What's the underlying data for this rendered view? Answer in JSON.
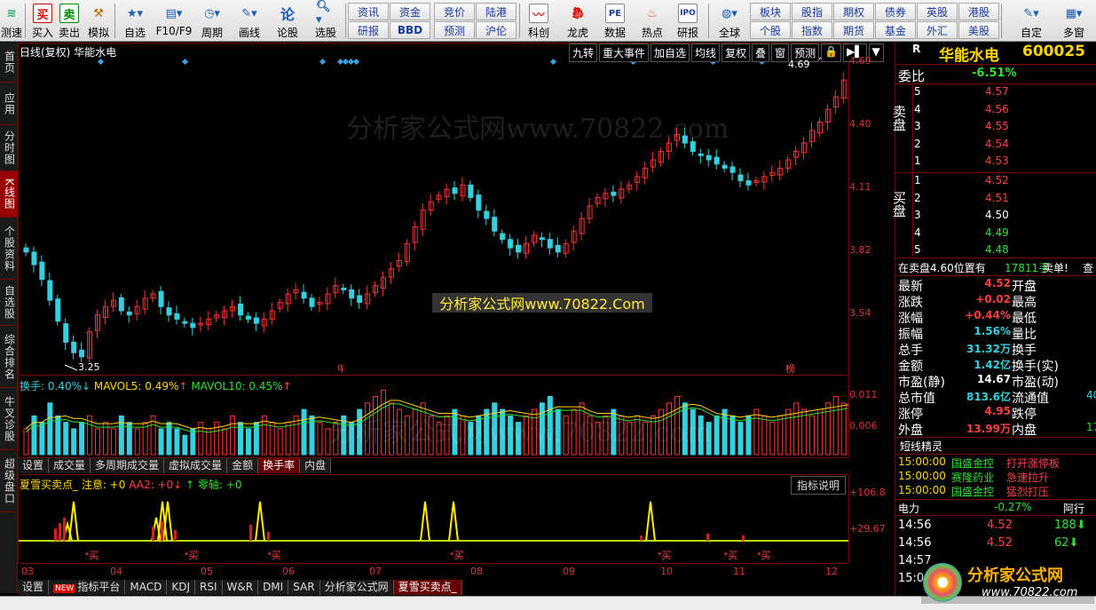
{
  "toolbar": {
    "left_buttons": [
      {
        "label": "测速",
        "icon": "wifi"
      },
      {
        "label": "买入",
        "icon": "买"
      },
      {
        "label": "卖出",
        "icon": "卖"
      },
      {
        "label": "模拟",
        "icon": "hammer"
      },
      {
        "label": "自选",
        "icon": "star"
      },
      {
        "label": "F10/F9",
        "icon": "list"
      },
      {
        "label": "周期",
        "icon": "clock"
      },
      {
        "label": "画线",
        "icon": "pencil"
      },
      {
        "label": "论股",
        "icon": "论"
      },
      {
        "label": "选股",
        "icon": "magnifier"
      }
    ],
    "grid1": [
      "资讯",
      "资金",
      "研报",
      "BBD"
    ],
    "grid2": [
      "竞价",
      "陆港",
      "预测",
      "沪伦"
    ],
    "mid_buttons": [
      {
        "label": "科创",
        "icon": "chart"
      },
      {
        "label": "龙虎",
        "icon": "dragon"
      },
      {
        "label": "数据",
        "icon": "PE"
      },
      {
        "label": "热点",
        "icon": "flame"
      },
      {
        "label": "研报",
        "icon": "IPO"
      }
    ],
    "globe_label": "全球",
    "grid3": [
      "板块",
      "股指",
      "期权",
      "债券",
      "英股",
      "港股",
      "个股",
      "指数",
      "期货",
      "基金",
      "外汇",
      "美股"
    ],
    "right_buttons": [
      {
        "label": "自定",
        "icon": "edit"
      },
      {
        "label": "多窗",
        "icon": "windows"
      }
    ]
  },
  "sidebar": [
    "首页",
    "应用",
    "分时图",
    "K线图",
    "个股资料",
    "自选股",
    "综合排名",
    "牛叉诊股",
    "超级盘口"
  ],
  "chart_header": {
    "title": "日线(复权) 华能水电",
    "tools": [
      "九转",
      "重大事件",
      "加自选",
      "均线",
      "复权",
      "叠",
      "窗",
      "预测",
      "🔒",
      "▶▌",
      "▼"
    ]
  },
  "price_axis": [
    "4.69",
    "4.40",
    "4.11",
    "3.82",
    "3.54"
  ],
  "kline_annotations": {
    "high_label": "4.69",
    "low_label": "3.25",
    "marker_q": "q",
    "marker_bang": "榜"
  },
  "chart_data": {
    "type": "bar",
    "title": "日线(复权) 华能水电",
    "y_range": [
      3.25,
      4.69
    ],
    "x_months": [
      "03",
      "04",
      "05",
      "06",
      "07",
      "08",
      "09",
      "10",
      "11",
      "12"
    ],
    "candles_close": [
      3.78,
      3.72,
      3.65,
      3.55,
      3.45,
      3.35,
      3.3,
      3.28,
      3.4,
      3.48,
      3.52,
      3.55,
      3.5,
      3.48,
      3.52,
      3.56,
      3.58,
      3.52,
      3.48,
      3.46,
      3.44,
      3.42,
      3.44,
      3.46,
      3.48,
      3.5,
      3.52,
      3.48,
      3.46,
      3.44,
      3.46,
      3.5,
      3.54,
      3.58,
      3.6,
      3.56,
      3.52,
      3.54,
      3.58,
      3.62,
      3.6,
      3.56,
      3.54,
      3.58,
      3.62,
      3.66,
      3.7,
      3.74,
      3.82,
      3.9,
      3.98,
      4.02,
      4.05,
      4.08,
      4.06,
      4.1,
      4.04,
      3.98,
      3.94,
      3.88,
      3.84,
      3.8,
      3.78,
      3.82,
      3.86,
      3.84,
      3.8,
      3.78,
      3.82,
      3.88,
      3.94,
      4.0,
      4.04,
      4.06,
      4.05,
      4.08,
      4.1,
      4.14,
      4.18,
      4.22,
      4.26,
      4.3,
      4.34,
      4.3,
      4.26,
      4.24,
      4.22,
      4.2,
      4.18,
      4.16,
      4.12,
      4.1,
      4.12,
      4.14,
      4.16,
      4.18,
      4.22,
      4.26,
      4.3,
      4.36,
      4.4,
      4.46,
      4.52,
      4.6,
      4.66,
      4.6,
      4.52
    ],
    "ylabel": "",
    "xlabel": ""
  },
  "volume_panel": {
    "legend_huanshou": "换手: 0.40%",
    "legend_mavol5": "MAVOL5: 0.49%",
    "legend_mavol10": "MAVOL10: 0.45%",
    "axis": [
      "0.011",
      "0.006"
    ],
    "values": [
      0.004,
      0.006,
      0.005,
      0.008,
      0.006,
      0.005,
      0.004,
      0.005,
      0.006,
      0.004,
      0.005,
      0.004,
      0.006,
      0.005,
      0.004,
      0.005,
      0.006,
      0.004,
      0.005,
      0.004,
      0.003,
      0.004,
      0.005,
      0.004,
      0.005,
      0.004,
      0.006,
      0.005,
      0.004,
      0.005,
      0.006,
      0.005,
      0.004,
      0.005,
      0.006,
      0.007,
      0.006,
      0.005,
      0.004,
      0.005,
      0.006,
      0.005,
      0.007,
      0.008,
      0.009,
      0.01,
      0.008,
      0.007,
      0.006,
      0.007,
      0.008,
      0.006,
      0.005,
      0.006,
      0.007,
      0.006,
      0.005,
      0.006,
      0.007,
      0.008,
      0.007,
      0.006,
      0.005,
      0.006,
      0.007,
      0.008,
      0.009,
      0.007,
      0.006,
      0.007,
      0.008,
      0.006,
      0.005,
      0.006,
      0.007,
      0.006,
      0.005,
      0.006,
      0.005,
      0.006,
      0.007,
      0.008,
      0.009,
      0.008,
      0.007,
      0.006,
      0.005,
      0.006,
      0.007,
      0.006,
      0.005,
      0.006,
      0.007,
      0.006,
      0.005,
      0.006,
      0.007,
      0.008,
      0.007,
      0.006,
      0.007,
      0.008,
      0.009,
      0.008,
      0.007,
      0.006,
      0.005
    ]
  },
  "sub_tabs": [
    "设置",
    "成交量",
    "多周期成交量",
    "虚拟成交量",
    "金额",
    "换手率",
    "内盘"
  ],
  "sub_tabs_active": "换手率",
  "indicator_panel": {
    "legend_name": "夏雪买卖点_ 注意: +0",
    "legend_aa2": "AA2: +0↓",
    "legend_zero": "↑ 零轴: +0",
    "help": "指标说明",
    "axis": [
      "+106.8",
      "+29.67"
    ],
    "buy_label": "*买",
    "buy_positions_pct": [
      0.08,
      0.2,
      0.3,
      0.52,
      0.77,
      0.85,
      0.89
    ]
  },
  "date_axis": [
    "03",
    "04",
    "05",
    "06",
    "07",
    "08",
    "09",
    "10",
    "11",
    "12"
  ],
  "bottom_tabs": [
    "设置",
    "指标平台",
    "MACD",
    "KDJ",
    "RSI",
    "W&R",
    "DMI",
    "SAR",
    "分析家公式网",
    "夏雪买卖点_"
  ],
  "bottom_tabs_active": "夏雪买卖点_",
  "new_badge": "NEW",
  "right_panel": {
    "stock_name": "华能水电",
    "stock_code": "600025",
    "R": "R",
    "weibi_label": "委比",
    "weibi_value": "-6.51%",
    "sell_label": "卖盘",
    "buy_label": "买盘",
    "sell": [
      {
        "level": "5",
        "price": "4.57"
      },
      {
        "level": "4",
        "price": "4.56"
      },
      {
        "level": "3",
        "price": "4.55"
      },
      {
        "level": "2",
        "price": "4.54"
      },
      {
        "level": "1",
        "price": "4.53"
      }
    ],
    "buy": [
      {
        "level": "1",
        "price": "4.52"
      },
      {
        "level": "2",
        "price": "4.51"
      },
      {
        "level": "3",
        "price": "4.50"
      },
      {
        "level": "4",
        "price": "4.49"
      },
      {
        "level": "5",
        "price": "4.48"
      }
    ],
    "notice_a": "在卖盘4.60位置有",
    "notice_b": "17811手",
    "notice_c": "卖单!",
    "notice_d": "查",
    "stats": [
      {
        "k": "最新",
        "v": "4.52",
        "k2": "开盘",
        "c": "red"
      },
      {
        "k": "涨跌",
        "v": "+0.02",
        "k2": "最高",
        "c": "red"
      },
      {
        "k": "涨幅",
        "v": "+0.44%",
        "k2": "最低",
        "c": "red"
      },
      {
        "k": "振幅",
        "v": "1.56%",
        "k2": "量比",
        "c": "cyan"
      },
      {
        "k": "总手",
        "v": "31.32万",
        "k2": "换手",
        "c": "cyan"
      },
      {
        "k": "金额",
        "v": "1.42亿",
        "k2": "换手(实)",
        "c": "cyan"
      },
      {
        "k": "市盈(静)",
        "v": "14.67",
        "k2": "市盈(动)",
        "c": "white"
      },
      {
        "k": "总市值",
        "v": "813.6亿",
        "k2": "流通值",
        "c": "cyan"
      },
      {
        "k": "涨停",
        "v": "4.95",
        "k2": "跌停",
        "c": "red"
      },
      {
        "k": "外盘",
        "v": "13.99万",
        "k2": "内盘",
        "c": "red"
      }
    ],
    "liutongzhi_tail": "40",
    "neipan_tail": "17",
    "sprite_title": "短线精灵",
    "sprites": [
      {
        "time": "15:00:00",
        "name": "国盛金控",
        "event": "打开涨停板"
      },
      {
        "time": "15:00:00",
        "name": "赛隆药业",
        "event": "急速拉升"
      },
      {
        "time": "15:00:00",
        "name": "国盛金控",
        "event": "猛烈打压"
      }
    ],
    "sector_name": "电力",
    "sector_change": "-0.27%",
    "sector_right": "阿行",
    "ticks": [
      {
        "time": "14:56",
        "price": "4.52",
        "vol": "188"
      },
      {
        "time": "14:56",
        "price": "4.52",
        "vol": "62"
      },
      {
        "time": "14:57",
        "price": "",
        "vol": ""
      },
      {
        "time": "15:00",
        "price": "",
        "vol": ""
      }
    ]
  },
  "watermark_text": "分析家公式网www.70822.com",
  "banner_text": "分析家公式网www.70822.Com",
  "logo_text": "分析家公式网",
  "logo_url": "www.70822.com",
  "colors": {
    "up": "#ff3333",
    "down": "#35d0e0",
    "frame": "#700000",
    "accent_yellow": "#ffd700"
  }
}
